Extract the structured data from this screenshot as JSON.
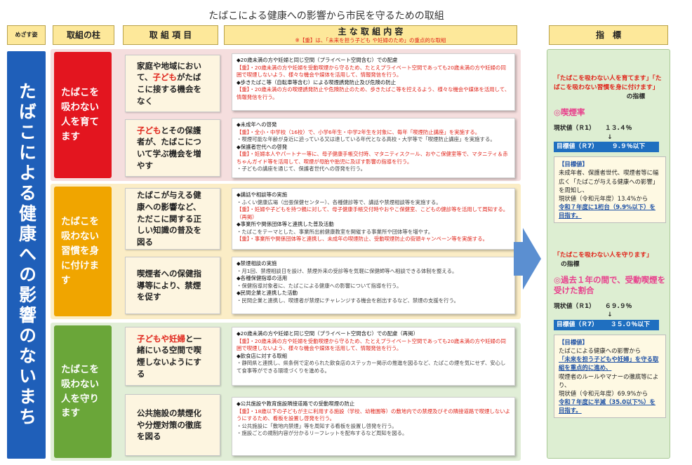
{
  "title": "たばこによる健康への影響から市民を守るための取組",
  "headers": {
    "goal": "めざす姿",
    "pillar": "取組の柱",
    "item": "取 組 項 目",
    "content": "主 な 取 組 内 容",
    "content_note": "※【重】は、「未来を担う子ども や妊婦のため」の重点的な取組",
    "indicator": "指　標"
  },
  "goal": "たばこによる健康への影響のないまち",
  "pillars": [
    {
      "label": "たばこを吸わない人を育てます",
      "color": "#e3151f"
    },
    {
      "label": "たばこを吸わない習慣を身に付けます",
      "color": "#f0a500"
    },
    {
      "label": "たばこを吸わない人を守ります",
      "color": "#6aa639"
    }
  ],
  "items": [
    {
      "pre": "家庭や地域において、",
      "red": "子ども",
      "post": "がたばこに接する機会をなく"
    },
    {
      "pre": "",
      "red": "子ども",
      "post": "とその保護者が、たばこについて学ぶ機会を増やす"
    },
    {
      "pre": "たばこが与える健康への影響など、ただこに関する正しい知識の普及を図る",
      "red": "",
      "post": ""
    },
    {
      "pre": "喫煙者への保健指導等により、禁煙を促す",
      "red": "",
      "post": ""
    },
    {
      "pre": "",
      "red": "子どもや妊婦",
      "post": "と一緒にいる空間で喫煙しないようにする"
    },
    {
      "pre": "公共施設の禁煙化や分煙対策の徹底を図る",
      "red": "",
      "post": ""
    }
  ],
  "contents": [
    [
      {
        "t": "h",
        "x": "◆20歳未満の方や妊婦と同じ空間（プライベート空間含む）での配慮"
      },
      {
        "t": "k",
        "x": "【重】・20歳未満の方や妊婦を受動喫煙から守るため、たとえプライベート空間であっても20歳未満の方や妊婦の同囲で喫煙しないよう、様々な機会や媒体を活用して、情報発信を行う。"
      },
      {
        "t": "h",
        "x": "◆歩きたばこ等（自転車等含む）による喫煙誘発防止及び危険の防止"
      },
      {
        "t": "k",
        "x": "【重】・20歳未満の方の喫煙誘発防止や危険防止のため、歩きたばこ等を控えるよう、様々な機会や媒体を活用して、情報発信を行う。"
      }
    ],
    [
      {
        "t": "h",
        "x": "◆未成年への啓発"
      },
      {
        "t": "k",
        "x": "【重】・全小・中学校（16校）で、小学6年生・中学2年生を対象に、毎年「喫煙防止講座」を実施する。"
      },
      {
        "t": "s",
        "x": "・喫煙可能な年齢が身近に迫っている又は達している年代となる高校・大学等で「喫煙防止講座」を実施する。"
      },
      {
        "t": "h",
        "x": "◆保護者世代への啓発"
      },
      {
        "t": "k",
        "x": "【重】・妊婦本人やパートナー等に、母子健康手帳交付時、マタニティスクール、おやこ保健室等で、マタニティ＆赤ちゃんガイド等を活用して、喫煙が母胎や胎児に及ぼす影響の指導を行う。"
      },
      {
        "t": "s",
        "x": "・子どもの講座を通じて、保護者世代への啓発を行う。"
      }
    ],
    [
      {
        "t": "h",
        "x": "◆講話や相談等の実施"
      },
      {
        "t": "s",
        "x": "・ふくい健康広場（出張保健センター）、各種健診等で、講話や禁煙相談等を実施する。"
      },
      {
        "t": "k",
        "x": "【重】・妊婦や子どもを持つ親に対して、母子健康手帳交付時やおやこ保健室、こどもの健診等を活用して周知する。（再掲）"
      },
      {
        "t": "h",
        "x": "◆事業所や関係団体等と連携した普及活動"
      },
      {
        "t": "s",
        "x": "・たばこをテーマとした、事業所出前健康教室を開催する事業所や団体等を増やす。"
      },
      {
        "t": "k",
        "x": "【重】・事業所や関係団体等と連携し、未成年の喫煙防止、受動喫煙防止の街頭キャンペーン等を実施する。"
      }
    ],
    [
      {
        "t": "h",
        "x": "◆禁煙相談の実施"
      },
      {
        "t": "s",
        "x": "・月1回、禁煙相談日を設け、禁煙外来の受診等を気軽に保健師等へ相談できる体制を整える。"
      },
      {
        "t": "h",
        "x": "◆各種保健指導の活用"
      },
      {
        "t": "s",
        "x": "・保健指導対象者に、たばこによる健康への影響について指導を行う。"
      },
      {
        "t": "h",
        "x": "◆民間企業と連携した活動"
      },
      {
        "t": "s",
        "x": "・民間企業と連携し、喫煙者が禁煙にチャレンジする機会を創出するなど、禁煙の支援を行う。"
      }
    ],
    [
      {
        "t": "h",
        "x": "◆20歳未満の方や妊婦と同じ空間（プライベート空間含む）での配慮（再掲）"
      },
      {
        "t": "k",
        "x": "【重】・20歳未満の方や妊婦を受動喫煙から守るため、たとえプライベート空間であっても20歳未満の方や妊婦の同囲で喫煙しないよう、様々な機会や媒体を活用して、情報発信を行う。"
      },
      {
        "t": "h",
        "x": "◆飲食店に対する取組"
      },
      {
        "t": "s",
        "x": "・静岡県と連携し、県条例で定められた飲食店のステッカー掲示の推進を図るなど、たばこの煙を気にせず、安心して食事等ができる環境づくりを進める。"
      }
    ],
    [
      {
        "t": "h",
        "x": "◆公共施設や教育施設隣接道路での受動喫煙の防止"
      },
      {
        "t": "k",
        "x": "【重】・18歳以下の子どもが主に利用する施設（学校、幼稚園等）の敷地内での禁煙及びその隣接道路で喫煙しないようにするため、看板を設置し啓発を行う。"
      },
      {
        "t": "s",
        "x": "・公共施設に「敷地内禁煙」等を周知する看板を設置し啓発を行う。"
      },
      {
        "t": "s",
        "x": "・施設ごとの規制内容が分かるリーフレットを配布するなど周知を図る。"
      }
    ]
  ],
  "indicator1": {
    "quote": "「たばこを吸わない人を育てます」「たばこを吸わない習慣を身に付けます」",
    "suffix": "の指標",
    "name": "◎喫煙率",
    "current_label": "現状値（Ｒ1）",
    "current_value": "１３.４％",
    "arrow": "↓",
    "target_label": "目標値（Ｒ7）",
    "target_value": "９.９％以下",
    "basis_title": "【目標値】",
    "basis": "未成年者、保護者世代、喫煙者等に幅広く「たばこが与える健康への影響」を周知し、",
    "basis2": "現状値（令和元年度）13.4%から",
    "basis3": "令和７年度に1桁台（9.9%以下）を目指す。"
  },
  "indicator2": {
    "quote": "「たばこを吸わない人を守ります」",
    "suffix": "の指標",
    "name": "◎過去１年の間で、受動喫煙を受けた割合",
    "current_label": "現状値（Ｒ1）",
    "current_value": "６９.９％",
    "arrow": "↓",
    "target_label": "目標値（Ｒ7）",
    "target_value": "３５.０％以下",
    "basis_title": "【目標値】",
    "basis": "たばこによる健康への影響から",
    "basis_em": "「未来を担う子どもや妊婦」を守る取組を重点的に進め、",
    "basis1b": "喫煙者のルールやマナーの徹底等により、",
    "basis2": "現状値（令和元年度）69.9%から",
    "basis3": "令和７年度に半減（35.0以下%）を目指す。"
  }
}
